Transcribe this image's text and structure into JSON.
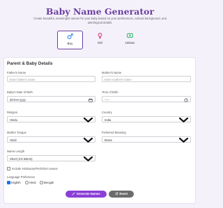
{
  "header": {
    "title": "Baby Name Generator",
    "subtitle": "Create beautiful, meaningful names for your baby based on your preferences, cultural background, and astrological details."
  },
  "gender": {
    "options": [
      {
        "label": "Boy",
        "selected": true,
        "icon": "male-symbol-icon"
      },
      {
        "label": "Girl",
        "selected": false,
        "icon": "female-symbol-icon"
      },
      {
        "label": "Unisex",
        "selected": false,
        "icon": "unisex-symbol-icon"
      }
    ]
  },
  "form": {
    "section_title": "Parent & Baby Details",
    "fathers_name": {
      "label": "Father's Name",
      "placeholder": "Enter father's name"
    },
    "mothers_name": {
      "label": "Mother's Name",
      "placeholder": "Enter mother's name"
    },
    "dob": {
      "label": "Baby's Date of Birth",
      "value": "dd-mm-yyyy"
    },
    "tob": {
      "label": "Time of Birth",
      "value": "--:--"
    },
    "religion": {
      "label": "Religion",
      "value": "Hindu"
    },
    "country": {
      "label": "Country",
      "value": "India"
    },
    "mother_tongue": {
      "label": "Mother Tongue",
      "value": "Hindi"
    },
    "preferred_meaning": {
      "label": "Preferred Meaning",
      "value": "Brave"
    },
    "name_length": {
      "label": "Name Length",
      "value": "Short (3-5 letters)"
    },
    "nickname_checkbox": {
      "label": "Include Nickname/Pet/Short names",
      "checked": false
    },
    "language": {
      "label": "Language Preference",
      "options": [
        {
          "label": "English",
          "checked": true
        },
        {
          "label": "Hindi",
          "checked": false
        },
        {
          "label": "Bengali",
          "checked": false
        }
      ]
    }
  },
  "actions": {
    "generate_label": "Generate Names",
    "reset_label": "Reset"
  },
  "colors": {
    "accent": "#6b3fa0",
    "generate_button": "#8b3fd6",
    "reset_button": "#6b6b6b",
    "boy_icon": "#2f80ed",
    "girl_icon": "#e0336a",
    "unisex_icon": "#27ae60"
  }
}
